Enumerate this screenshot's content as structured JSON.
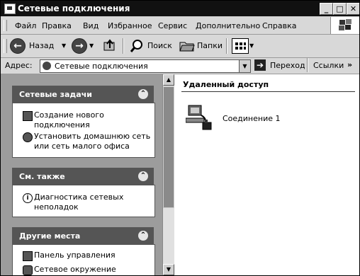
{
  "window": {
    "title": "Сетевые подключения"
  },
  "menu": [
    "Файл",
    "Правка",
    "Вид",
    "Избранное",
    "Сервис",
    "Дополнительно",
    "Справка"
  ],
  "toolbar": {
    "back": "Назад",
    "search": "Поиск",
    "folders": "Папки"
  },
  "address": {
    "label": "Адрес:",
    "value": "Сетевые подключения",
    "go": "Переход",
    "links": "Ссылки"
  },
  "sidebar": {
    "network_tasks": {
      "title": "Сетевые задачи",
      "items": [
        "Создание нового подключения",
        "Установить домашнюю сеть или сеть малого офиса"
      ]
    },
    "see_also": {
      "title": "См. также",
      "items": [
        "Диагностика сетевых неполадок"
      ]
    },
    "other_places": {
      "title": "Другие места",
      "items": [
        "Панель управления",
        "Сетевое окружение"
      ]
    }
  },
  "content": {
    "group_title": "Удаленный доступ",
    "connection_label": "Соединение 1"
  }
}
